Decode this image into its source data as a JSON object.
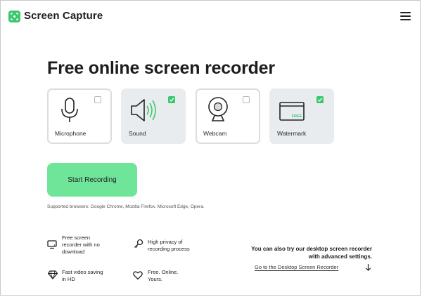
{
  "header": {
    "brand": "Screen Capture",
    "logo_icon": "camera-focus-icon",
    "menu_icon": "hamburger-menu-icon"
  },
  "page": {
    "title": "Free online screen recorder"
  },
  "options": [
    {
      "label": "Microphone",
      "icon": "microphone-icon",
      "checked": false
    },
    {
      "label": "Sound",
      "icon": "speaker-icon",
      "checked": true
    },
    {
      "label": "Webcam",
      "icon": "webcam-icon",
      "checked": false
    },
    {
      "label": "Watermark",
      "icon": "watermark-icon",
      "checked": true,
      "badge": "FREE"
    }
  ],
  "start_button": "Start Recording",
  "supported_browsers": "Supported browsers: Google Chrome, Mozilla Firefox, Microsoft Edge, Opera.",
  "features": [
    {
      "icon": "monitor-icon",
      "lines": [
        "Free screen",
        "recorder with no",
        "download"
      ]
    },
    {
      "icon": "privacy-key-icon",
      "lines": [
        "High privacy of",
        "recording process"
      ]
    },
    {
      "icon": "diamond-icon",
      "lines": [
        "Fast video saving",
        "in HD"
      ]
    },
    {
      "icon": "heart-icon",
      "lines": [
        "Free. Online.",
        "Yours."
      ]
    }
  ],
  "promo": {
    "lines": [
      "You can also try our desktop screen recorder",
      "with advanced settings."
    ],
    "link": "Go to the Desktop Screen Recorder",
    "link_icon": "arrow-down-icon"
  },
  "colors": {
    "accent": "#6fe59a",
    "brand_green": "#3cc66f",
    "card_selected": "#e9ecef"
  }
}
